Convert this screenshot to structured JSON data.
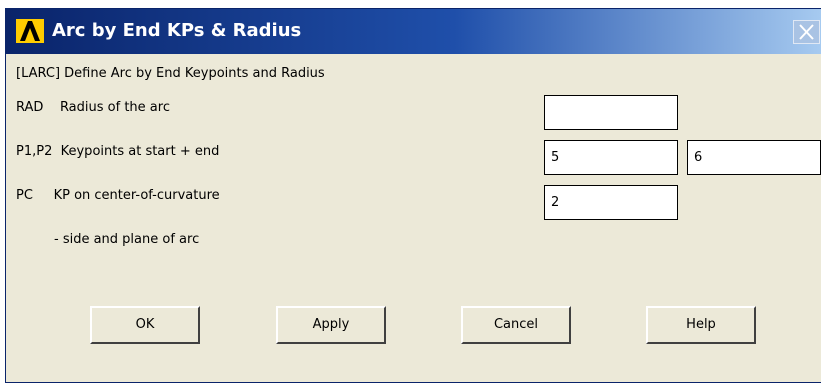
{
  "window": {
    "title": "Arc by End KPs & Radius",
    "colors": {
      "title_bar": "#0a246a",
      "body": "#ece9d8",
      "logo": "#ffcc00"
    }
  },
  "dialog": {
    "heading": "[LARC]  Define Arc by End Keypoints and Radius",
    "fields": {
      "rad": {
        "label": "RAD    Radius of the arc",
        "value": ""
      },
      "p1p2": {
        "label": "P1,P2  Keypoints at start + end",
        "p1_value": "5",
        "p2_value": "6"
      },
      "pc": {
        "label": "PC     KP on center-of-curvature",
        "value": "2",
        "sublabel": "- side and plane of arc"
      }
    }
  },
  "buttons": {
    "ok": "OK",
    "apply": "Apply",
    "cancel": "Cancel",
    "help": "Help"
  },
  "icons": {
    "logo": "ansys-logo-icon",
    "close": "close-icon"
  }
}
